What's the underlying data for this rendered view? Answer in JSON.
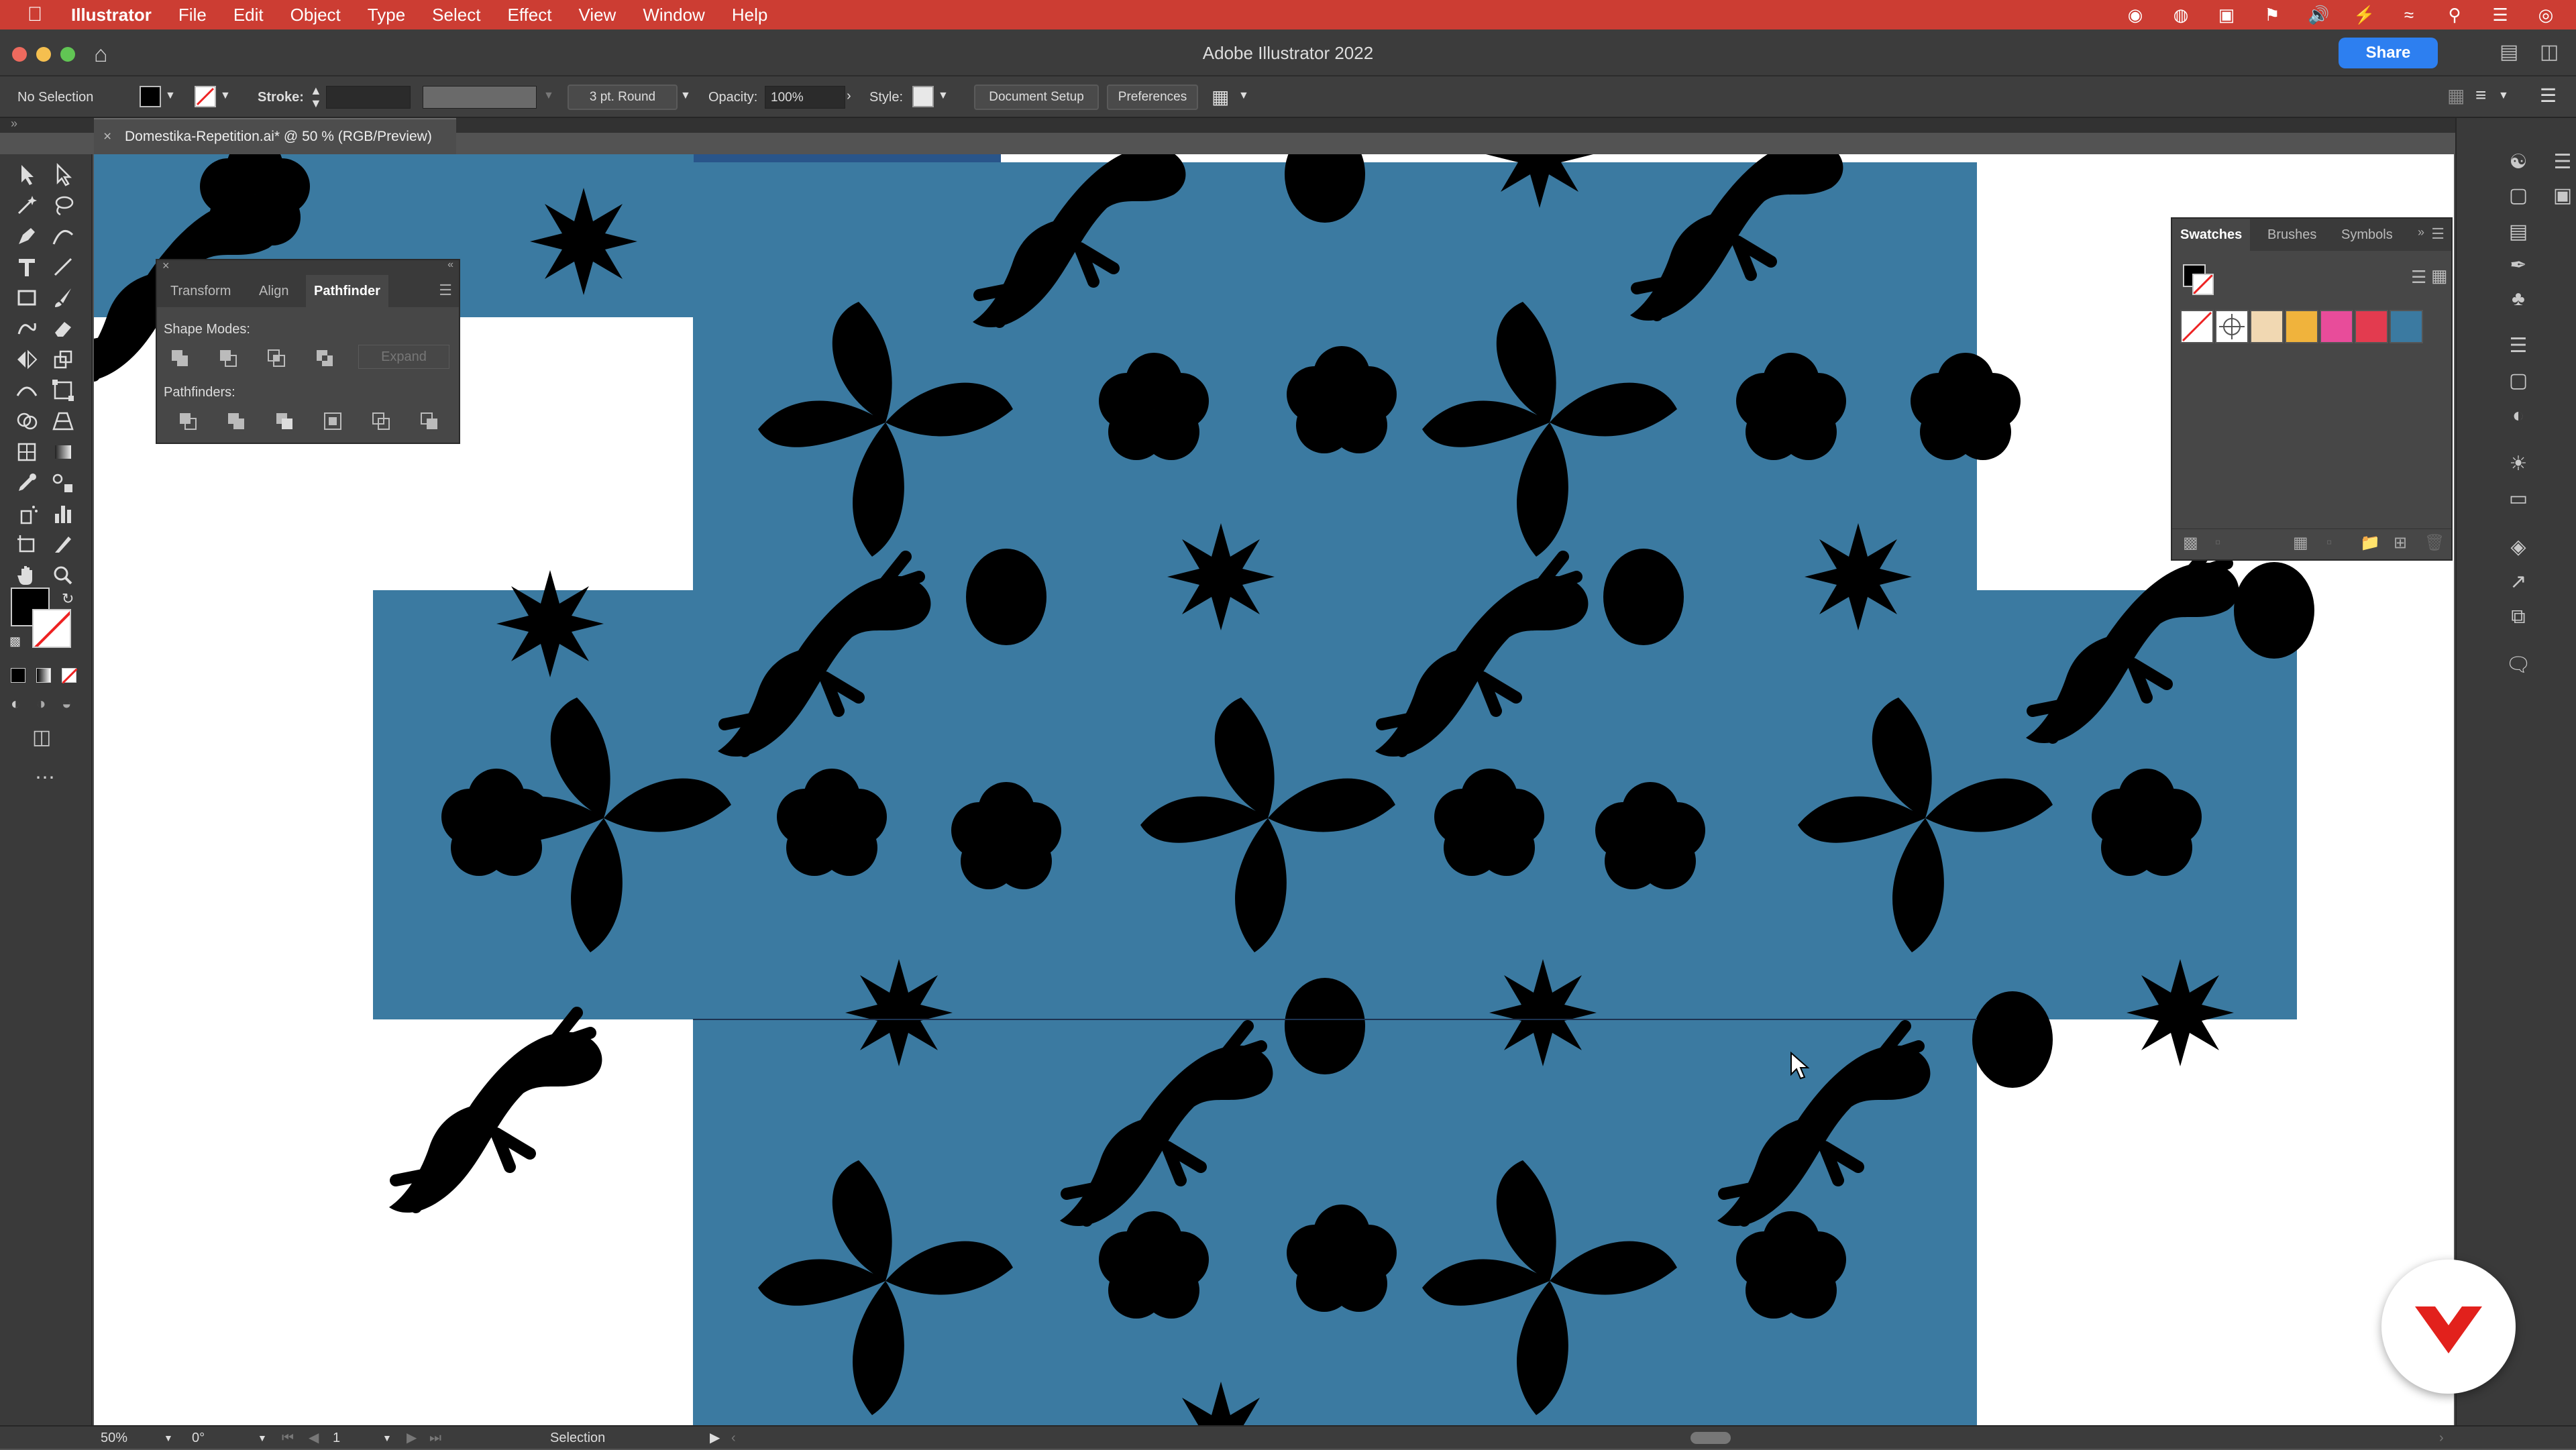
{
  "menubar": {
    "app_name": "Illustrator",
    "items": [
      "File",
      "Edit",
      "Object",
      "Type",
      "Select",
      "Effect",
      "View",
      "Window",
      "Help"
    ]
  },
  "window": {
    "title": "Adobe Illustrator 2022",
    "share_label": "Share"
  },
  "control_bar": {
    "selection_label": "No Selection",
    "stroke_label": "Stroke:",
    "brush_label": "3 pt. Round",
    "opacity_label": "Opacity:",
    "opacity_value": "100%",
    "style_label": "Style:",
    "document_setup": "Document Setup",
    "preferences": "Preferences"
  },
  "document_tab": {
    "label": "Domestika-Repetition.ai* @ 50 % (RGB/Preview)"
  },
  "pathfinder_panel": {
    "tabs": [
      "Transform",
      "Align",
      "Pathfinder"
    ],
    "shape_modes_label": "Shape Modes:",
    "expand_label": "Expand",
    "pathfinders_label": "Pathfinders:"
  },
  "swatches_panel": {
    "tabs": [
      "Swatches",
      "Brushes",
      "Symbols"
    ],
    "swatches": [
      "none",
      "registration",
      "#f1d8b2",
      "#f0b33c",
      "#e84c9a",
      "#e33b4f",
      "#3b7aa1"
    ]
  },
  "status_bar": {
    "zoom": "50%",
    "rotation": "0°",
    "artboard_number": "1",
    "tool_name": "Selection"
  },
  "colors": {
    "menubar": "#cc3d33",
    "tile_blue": "#3b7aa1",
    "share_blue": "#2d7ff0",
    "brand_red": "#e2211c"
  }
}
